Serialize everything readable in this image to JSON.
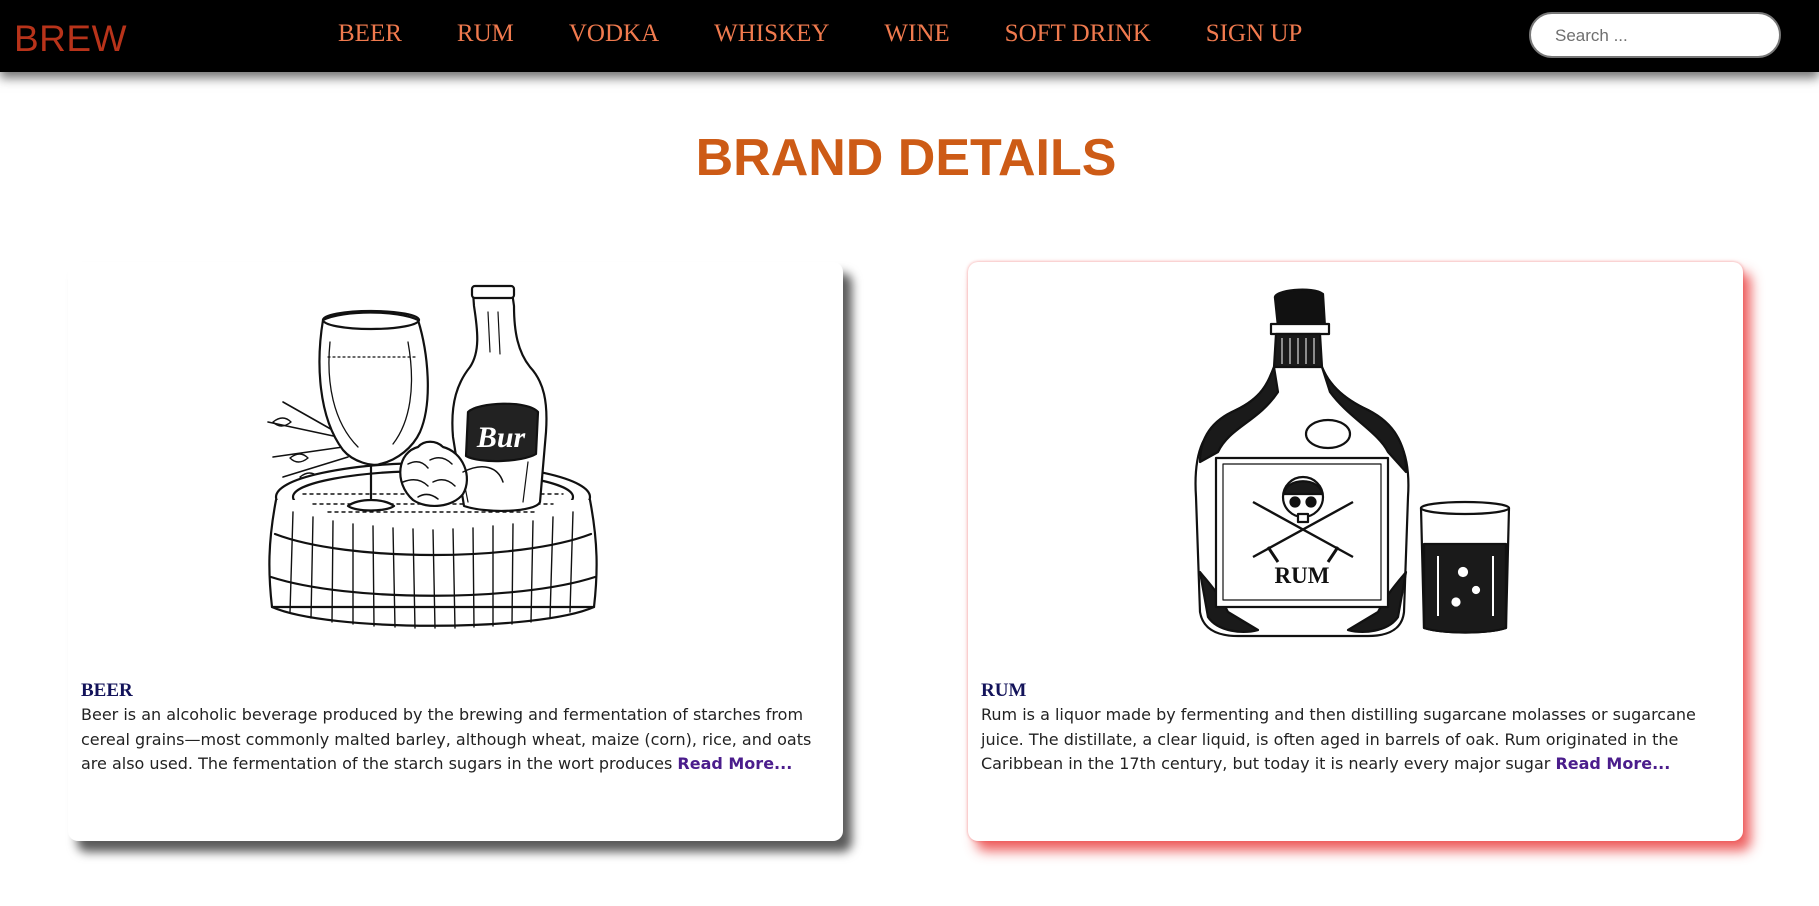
{
  "nav": {
    "logo": "BREW",
    "links": [
      "BEER",
      "RUM",
      "VODKA",
      "WHISKEY",
      "WINE",
      "SOFT DRINK",
      "SIGN UP"
    ],
    "search_placeholder": "Search ...",
    "colors": {
      "background": "#000000",
      "logo": "#b8331a",
      "links": "#f07a4e"
    }
  },
  "page": {
    "title": "BRAND DETAILS",
    "title_color": "#cd5b16"
  },
  "cards": [
    {
      "title": "BEER",
      "text": "Beer is an alcoholic beverage produced by the brewing and fermentation of starches from cereal grains—most commonly malted barley, although wheat, maize (corn), rice, and oats are also used. The fermentation of the starch sugars in the wort produces",
      "read_more": "Read More...",
      "image_label": "Bur",
      "image": "beer-glass-bottle-barrel-sketch"
    },
    {
      "title": "RUM",
      "text": "Rum is a liquor made by fermenting and then distilling sugarcane molasses or sugarcane juice. The distillate, a clear liquid, is often aged in barrels of oak. Rum originated in the Caribbean in the 17th century, but today it is nearly every major sugar",
      "read_more": "Read More...",
      "image_label": "RUM",
      "image": "rum-bottle-glass-sketch"
    }
  ]
}
